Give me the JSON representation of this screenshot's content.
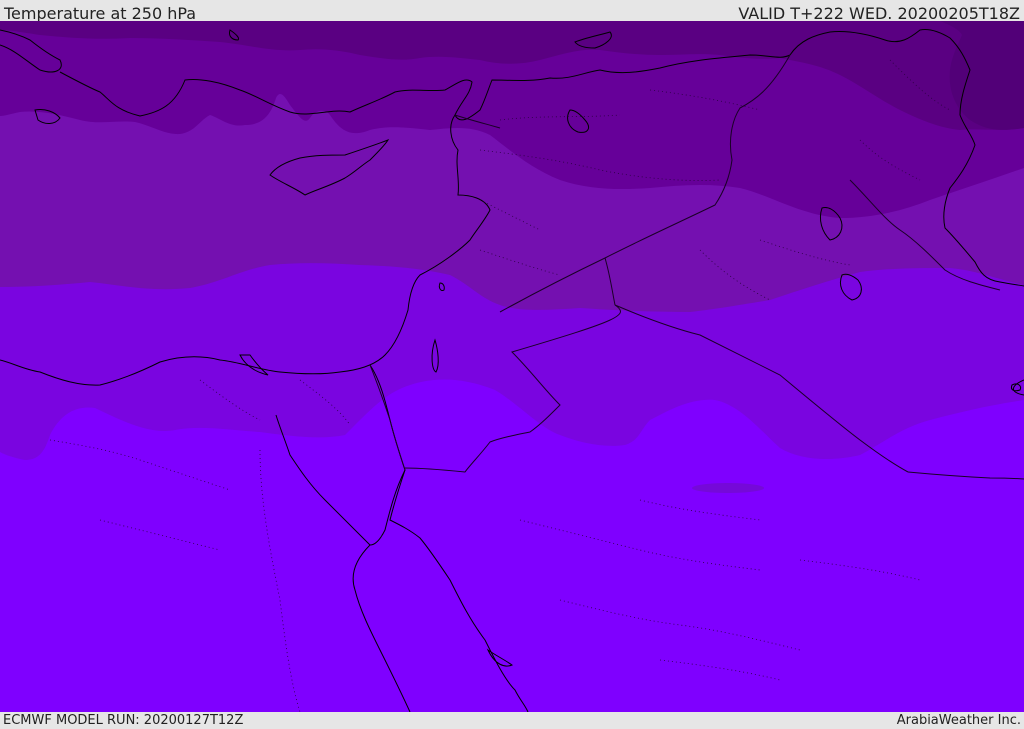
{
  "header": {
    "title": "Temperature at 250 hPa",
    "valid": "VALID T+222 WED. 20200205T18Z"
  },
  "footer": {
    "model_run": "ECMWF MODEL RUN: 20200127T12Z",
    "credit": "ArabiaWeather Inc."
  },
  "map": {
    "field": "Temperature at 250 hPa",
    "colors": {
      "band_darkest": "#5a0082",
      "band_dark": "#660099",
      "band_mid": "#7410b0",
      "band_light": "#7c00d6",
      "band_brightest": "#7f00ff",
      "coastline": "#000000",
      "border": "#1a0026"
    }
  }
}
